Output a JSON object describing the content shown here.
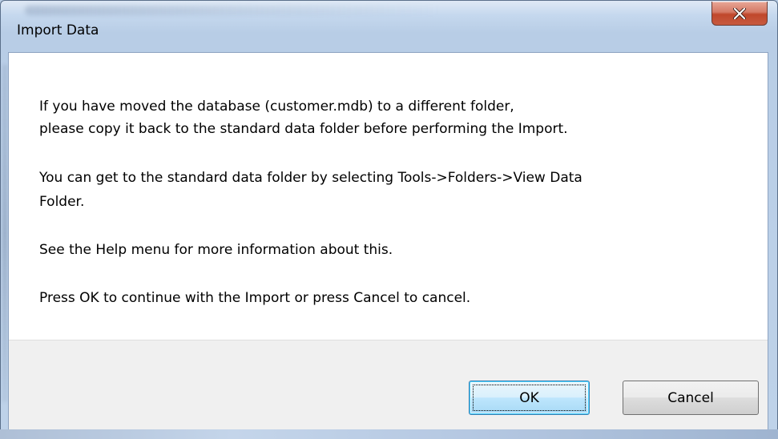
{
  "window": {
    "title": "Import Data",
    "close_glyph": "X"
  },
  "message": {
    "lines": [
      "If you have moved the database (customer.mdb) to a different folder,",
      "please copy it back to the standard data folder before performing the Import.",
      "You can get to the standard data folder by selecting Tools->Folders->View Data",
      "Folder.",
      "See the Help menu for more information about this.",
      "Press OK to continue with the Import or press Cancel to cancel."
    ]
  },
  "buttons": {
    "ok_label": "OK",
    "cancel_label": "Cancel"
  },
  "icons": {
    "close": "close-icon"
  },
  "colors": {
    "close_button": "#c75a3f",
    "frame": "#bed2e9",
    "footer": "#f0f0f0",
    "default_button_border": "#3c7fb1"
  }
}
